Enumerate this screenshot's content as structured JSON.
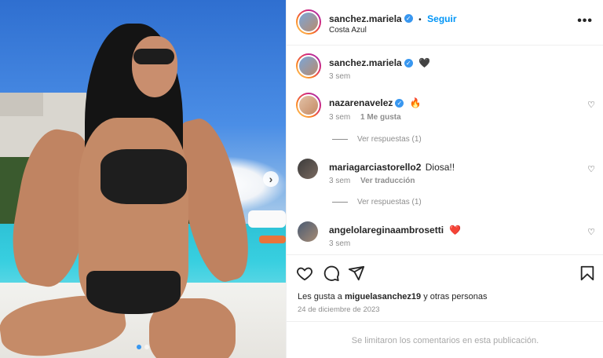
{
  "post": {
    "username": "sanchez.mariela",
    "verified": true,
    "separator": "•",
    "follow_label": "Seguir",
    "location": "Costa Azul",
    "more_icon": "more-horizontal-icon"
  },
  "caption": {
    "username": "sanchez.mariela",
    "text": "🖤",
    "time": "3 sem"
  },
  "comments": [
    {
      "username": "nazarenavelez",
      "text": "🔥",
      "time": "3 sem",
      "likes": "1 Me gusta",
      "replies": "Ver respuestas (1)"
    },
    {
      "username": "mariagarciastorello2",
      "text": "Diosa!!",
      "time": "3 sem",
      "translate": "Ver traducción",
      "replies": "Ver respuestas (1)"
    },
    {
      "username": "angelolareginaambrosetti",
      "text": "❤️",
      "time": "3 sem"
    }
  ],
  "actions": {
    "like_icon": "heart-icon",
    "comment_icon": "comment-icon",
    "share_icon": "share-icon",
    "save_icon": "bookmark-icon"
  },
  "likes": {
    "prefix": "Les gusta a",
    "user": "miguelasanchez19",
    "suffix": "y otras personas"
  },
  "date": "24 de diciembre de 2023",
  "comments_limited": "Se limitaron los comentarios en esta publicación.",
  "carousel": {
    "next_label": "›",
    "slide_count": 2,
    "active_index": 0
  }
}
